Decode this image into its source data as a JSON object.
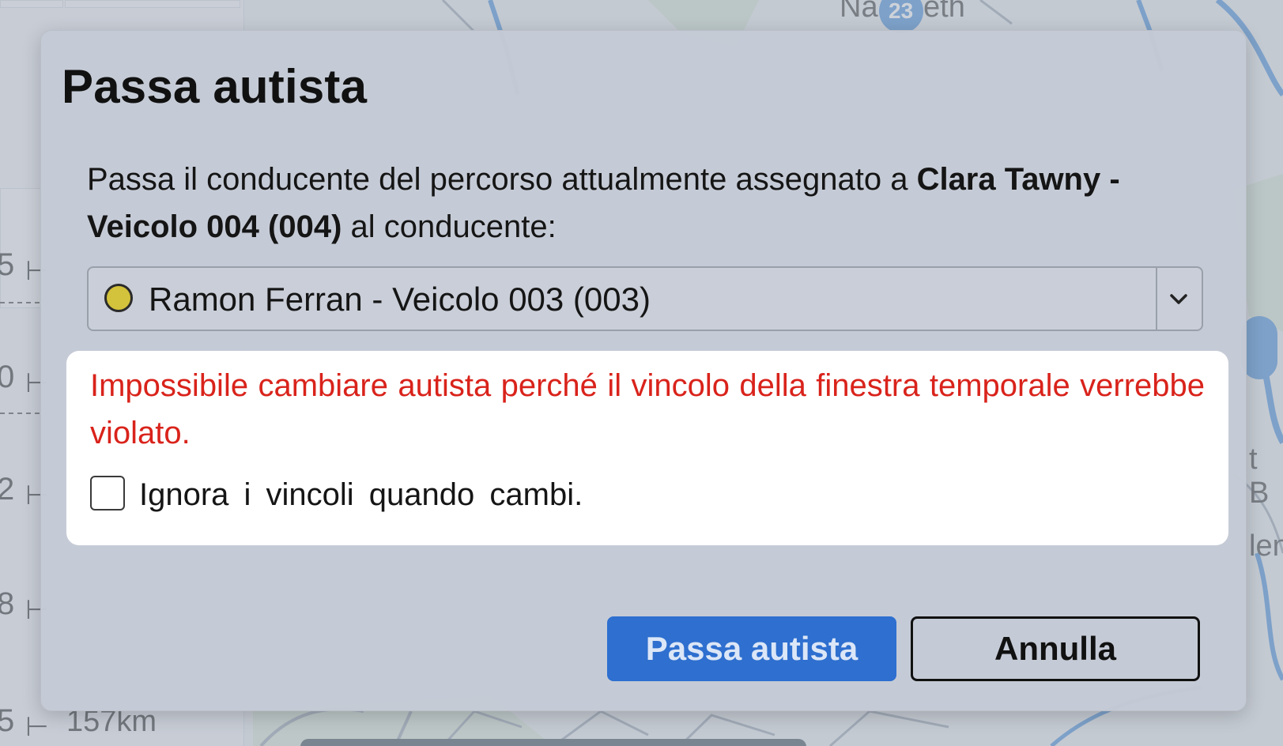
{
  "background": {
    "route_list": {
      "numbers": [
        "5",
        "0",
        "2",
        "8",
        "5"
      ],
      "visible_distance": "157km"
    },
    "map_labels": [
      "Na",
      "eth",
      "t B",
      "len"
    ],
    "map_badge_number": "23"
  },
  "modal": {
    "title": "Passa autista",
    "description_prefix": "Passa il conducente del percorso attualmente assegnato a",
    "current_driver": "Clara Tawny - Veicolo 004 (004)",
    "description_suffix": "al conducente:",
    "driver_select": {
      "selected_value": "Ramon Ferran - Veicolo 003 (003)",
      "status_color": "#d3c23b",
      "icon": "chevron-down-icon"
    },
    "error_message": "Impossibile cambiare autista perché il vincolo della finestra temporale verrebbe violato.",
    "ignore_constraints": {
      "label": "Ignora i vincoli quando cambi.",
      "checked": false
    },
    "buttons": {
      "confirm_label": "Passa autista",
      "cancel_label": "Annulla"
    }
  },
  "colors": {
    "primary": "#2e6fcf",
    "error": "#d9231b",
    "map_water": "#2f7fd6"
  }
}
